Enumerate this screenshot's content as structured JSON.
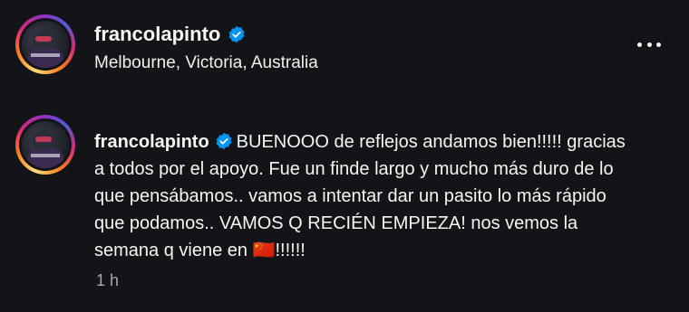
{
  "header": {
    "username": "francolapinto",
    "location": "Melbourne, Victoria, Australia",
    "more_icon": "more-horizontal-icon"
  },
  "post": {
    "username": "francolapinto",
    "caption": "BUENOOO de reflejos andamos bien!!!!! gracias a todos por el apoyo. Fue un finde largo y mucho más duro de lo que pensábamos.. vamos a intentar dar un pasito lo más rápido que podamos.. VAMOS Q RECIÉN EMPIEZA! nos vemos la semana q viene en 🇨🇳!!!!!!",
    "timestamp": "1 h"
  },
  "colors": {
    "background": "#131418",
    "verified_blue": "#0095f6",
    "muted_text": "#a8a8a8"
  }
}
